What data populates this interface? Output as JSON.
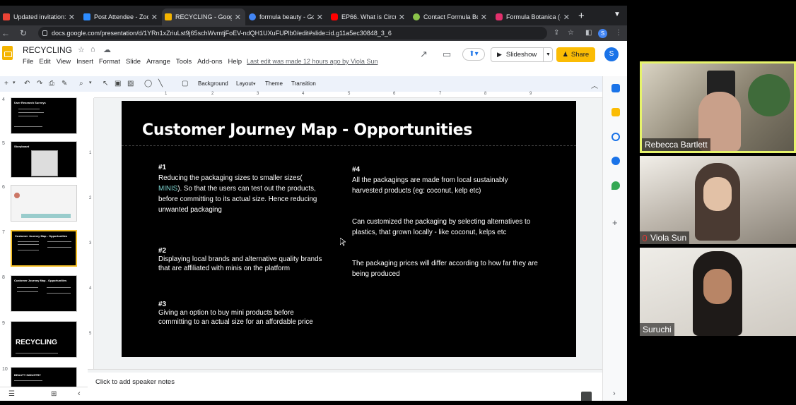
{
  "browser": {
    "tabs": [
      {
        "label": "Updated invitation: C",
        "icon": "gmail-icon",
        "color": "#ea4335",
        "active": false
      },
      {
        "label": "Post Attendee - Zoom",
        "icon": "zoom-icon",
        "color": "#2d8cff",
        "active": false
      },
      {
        "label": "RECYCLING - Google",
        "icon": "slides-icon",
        "color": "#f4b400",
        "active": true
      },
      {
        "label": "formula beauty - Goo",
        "icon": "google-icon",
        "color": "#4285f4",
        "active": false
      },
      {
        "label": "EP66. What is Circula",
        "icon": "youtube-icon",
        "color": "#ff0000",
        "active": false
      },
      {
        "label": "Contact Formula Bota",
        "icon": "leaf-icon",
        "color": "#8bc34a",
        "active": false
      },
      {
        "label": "Formula Botanica (@",
        "icon": "instagram-icon",
        "color": "#e1306c",
        "active": false
      }
    ],
    "new_tab": "+",
    "url": "docs.google.com/presentation/d/1YRn1xZriuLst9j65schWvmtjFoEV-ndQH1UXuFUPlb0/edit#slide=id.g11a5ec30848_3_6",
    "profile_initial": "S"
  },
  "doc": {
    "title": "RECYCLING",
    "menu": [
      "File",
      "Edit",
      "View",
      "Insert",
      "Format",
      "Slide",
      "Arrange",
      "Tools",
      "Add-ons",
      "Help"
    ],
    "last_edit": "Last edit was made 12 hours ago by Viola Sun",
    "slideshow_label": "Slideshow",
    "share_label": "Share",
    "avatar_initial": "S"
  },
  "toolbar": {
    "background": "Background",
    "layout": "Layout",
    "theme": "Theme",
    "transition": "Transition"
  },
  "filmstrip": {
    "numbers": [
      "4",
      "5",
      "6",
      "7",
      "8",
      "9",
      "10"
    ],
    "titles": [
      "User Research Surveys",
      "Storyboard",
      "",
      "Customer Journey Map - Opportunities",
      "Customer Journey Map - Opportunities",
      "RECYCLING",
      "BEAUTY INDUSTRY"
    ],
    "selected_index": 3
  },
  "ruler": {
    "top": [
      "1",
      "2",
      "3",
      "4",
      "5",
      "6",
      "7",
      "8",
      "9"
    ],
    "left": [
      "1",
      "2",
      "3",
      "4",
      "5"
    ]
  },
  "slide": {
    "title": "Customer Journey Map - Opportunities",
    "items": [
      {
        "heading": "#1",
        "body_a": "Reducing the packaging sizes to smaller sizes(",
        "body_highlight": " MINIS",
        "body_b": "). So that the users can test out the products, before committing to its actual size. Hence reducing unwanted packaging"
      },
      {
        "heading": "#2",
        "body": "Displaying local brands and alternative quality brands that are affiliated with minis on the platform"
      },
      {
        "heading": "#3",
        "body": "Giving an option to buy mini products before committing to an actual size for an affordable price"
      },
      {
        "heading": "#4",
        "body": "All the packagings are made from local sustainably harvested products (eg: coconut, kelp etc)"
      }
    ],
    "extra": [
      "Can customized the packaging by selecting alternatives to plastics, that grown locally  - like coconut, kelps etc",
      "The packaging prices will differ according to how far they are being produced"
    ],
    "highlight_color": "#7fd6d2"
  },
  "notes": {
    "placeholder": "Click to add speaker notes"
  },
  "participants": [
    {
      "name": "Rebecca Bartlett",
      "muted": false
    },
    {
      "name": "Viola Sun",
      "muted": true
    },
    {
      "name": "Suruchi",
      "muted": false
    }
  ],
  "colors": {
    "share": "#fbbc04",
    "accent": "#1a73e8",
    "speaker_border": "#e6f36b"
  }
}
